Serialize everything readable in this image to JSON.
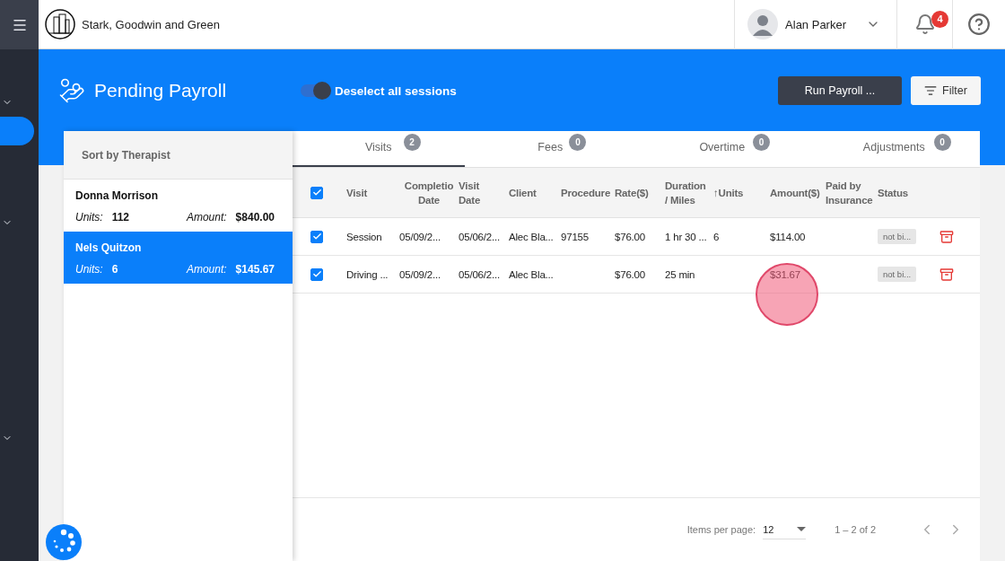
{
  "header": {
    "brand": "Stark, Goodwin and Green",
    "user": "Alan Parker",
    "notifications": "4"
  },
  "page": {
    "title": "Pending Payroll",
    "toggle": {
      "label": "Deselect all sessions",
      "on": true
    },
    "run_button": "Run Payroll ...",
    "filter_button": "Filter"
  },
  "therapists": {
    "title": "Sort by Therapist",
    "items": [
      {
        "name": "Donna Morrison",
        "units_label": "Units:",
        "units": "112",
        "amount_label": "Amount:",
        "amount": "$840.00",
        "selected": false
      },
      {
        "name": "Nels Quitzon",
        "units_label": "Units:",
        "units": "6",
        "amount_label": "Amount:",
        "amount": "$145.67",
        "selected": true
      }
    ]
  },
  "tabs": [
    {
      "label": "Visits",
      "count": "2",
      "selected": true
    },
    {
      "label": "Fees",
      "count": "0",
      "selected": false
    },
    {
      "label": "Overtime",
      "count": "0",
      "selected": false
    },
    {
      "label": "Adjustments",
      "count": "0",
      "selected": false
    }
  ],
  "table": {
    "select_all": true,
    "columns": [
      "Visit",
      "Completio\nDate",
      "Visit\nDate",
      "Client",
      "Procedure",
      "Rate($)",
      "Duration\n/ Miles",
      "↑Units",
      "Amount($)",
      "Paid by\nInsurance",
      "Status"
    ],
    "rows": [
      {
        "checked": true,
        "cells": [
          "Session",
          "05/09/2...",
          "05/06/2...",
          "Alec Bla...",
          "97155",
          "$76.00",
          "1 hr 30 ...",
          "6",
          "$114.00",
          ""
        ],
        "status": "not bi..."
      },
      {
        "checked": true,
        "cells": [
          "Driving ...",
          "05/09/2...",
          "05/06/2...",
          "Alec Bla...",
          "",
          "$76.00",
          "25 min",
          "",
          "$31.67",
          ""
        ],
        "status": "not bi..."
      }
    ]
  },
  "pagination": {
    "label": "Items per page:",
    "per_page": "12",
    "range": "1 – 2 of 2"
  }
}
